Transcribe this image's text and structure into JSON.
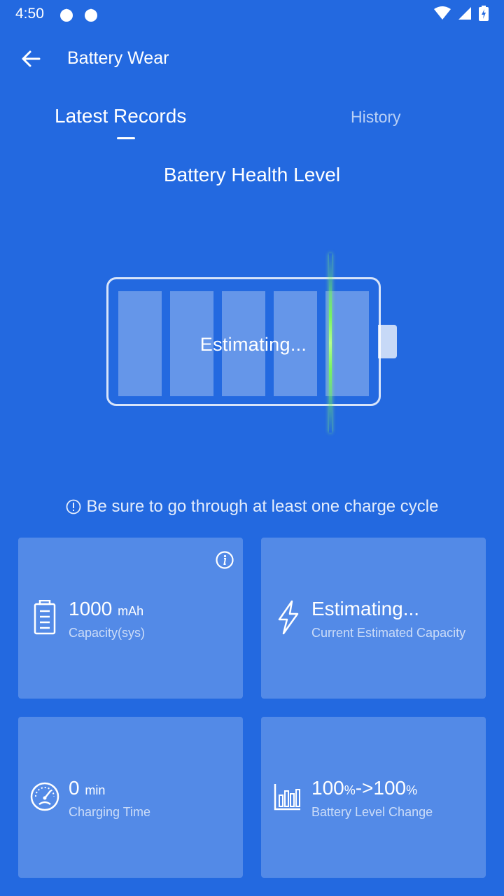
{
  "status_bar": {
    "time": "4:50"
  },
  "toolbar": {
    "title": "Battery Wear"
  },
  "tabs": [
    {
      "label": "Latest Records",
      "selected": true
    },
    {
      "label": "History",
      "selected": false
    }
  ],
  "section_title": "Battery Health Level",
  "battery": {
    "status": "Estimating..."
  },
  "hint": "Be sure to go through at least one charge cycle",
  "cards": [
    {
      "icon": "battery-icon",
      "value": "1000",
      "unit": "mAh",
      "label": "Capacity(sys)",
      "has_info": true
    },
    {
      "icon": "lightning-icon",
      "value": "Estimating...",
      "unit": "",
      "label": "Current Estimated Capacity"
    },
    {
      "icon": "speedometer-icon",
      "value": "0",
      "unit": "min",
      "label": "Charging Time"
    },
    {
      "icon": "bar-chart-icon",
      "value_parts": [
        "100",
        "%",
        "->100",
        "%"
      ],
      "label": "Battery Level Change"
    }
  ],
  "colors": {
    "background": "#2369E0",
    "scan_line": "#7CFF52"
  }
}
